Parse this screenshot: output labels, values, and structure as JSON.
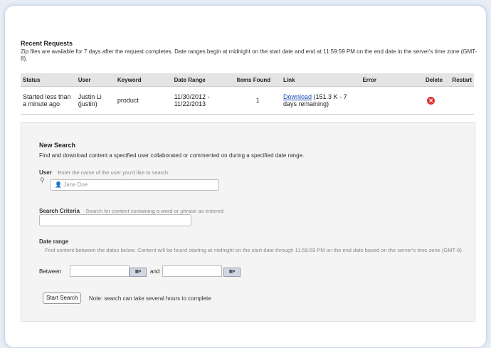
{
  "recent": {
    "title": "Recent Requests",
    "desc": "Zip files are available for 7 days after the request completes. Date ranges begin at midnight on the start date and end at 11:59:59 PM on the end date in the server's time zone (GMT-8).",
    "columns": [
      "Status",
      "User",
      "Keyword",
      "Date Range",
      "Items Found",
      "Link",
      "Error",
      "Delete",
      "Restart"
    ],
    "rows": [
      {
        "status": "Started less than a minute ago",
        "user": "Justin Li (justin)",
        "keyword": "product",
        "date_range": "11/30/2012 - 11/22/2013",
        "items_found": "1",
        "link_text": "Download",
        "link_suffix": " (151.3 K - 7 days remaining)",
        "error": "",
        "delete_icon": "delete-x-icon"
      }
    ]
  },
  "new_search": {
    "title": "New Search",
    "desc": "Find and download content a specified user collaborated or commented on during a specified date range.",
    "user_label": "User",
    "user_hint": "Enter the name of the user you'd like to search",
    "user_placeholder": "Jane Doe",
    "criteria_label": "Search Criteria",
    "criteria_hint": "Search for content containing a word or phrase as entered.",
    "date_label": "Date range",
    "date_desc": "Find content between the dates below. Content will be found starting at midnight on the start date through 11:59:59 PM on the end date based on the server's time zone (GMT-8).",
    "between": "Between",
    "and": "and",
    "button": "Start Search",
    "note": "Note: search can take several hours to complete"
  }
}
